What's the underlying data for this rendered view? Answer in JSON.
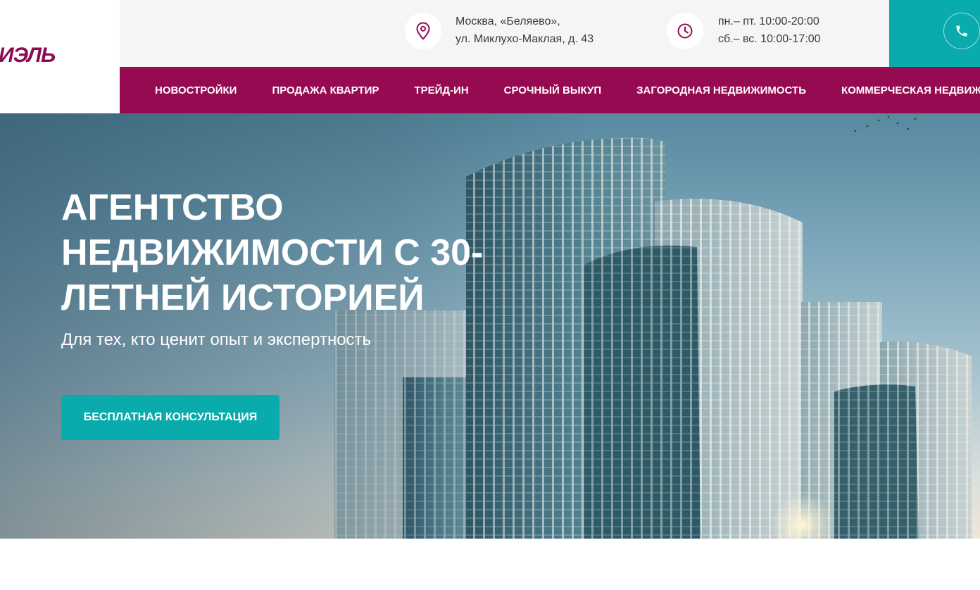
{
  "logo": {
    "text": "ИЭЛЬ"
  },
  "contacts": {
    "address_line1": "Москва, «Беляево»,",
    "address_line2": "ул. Миклухо-Маклая, д. 43",
    "hours_line1": "пн.– пт. 10:00-20:00",
    "hours_line2": "сб.– вс. 10:00-17:00",
    "location_icon": "location-pin-icon",
    "clock_icon": "clock-icon",
    "phone_icon": "phone-icon"
  },
  "nav": {
    "items": [
      {
        "label": "НОВОСТРОЙКИ"
      },
      {
        "label": "ПРОДАЖА КВАРТИР"
      },
      {
        "label": "ТРЕЙД-ИН"
      },
      {
        "label": "СРОЧНЫЙ ВЫКУП"
      },
      {
        "label": "ЗАГОРОДНАЯ НЕДВИЖИМОСТЬ"
      },
      {
        "label": "КОММЕРЧЕСКАЯ НЕДВИЖИМОСТЬ"
      }
    ]
  },
  "hero": {
    "title": "АГЕНТСТВО НЕДВИЖИМОСТИ С 30-ЛЕТНЕЙ ИСТОРИЕЙ",
    "subtitle": "Для тех, кто ценит опыт и экспертность",
    "cta_label": "БЕСПЛАТНАЯ КОНСУЛЬТАЦИЯ"
  },
  "colors": {
    "brand": "#960a52",
    "accent": "#0aabad",
    "topbar": "#f5f5f5"
  }
}
